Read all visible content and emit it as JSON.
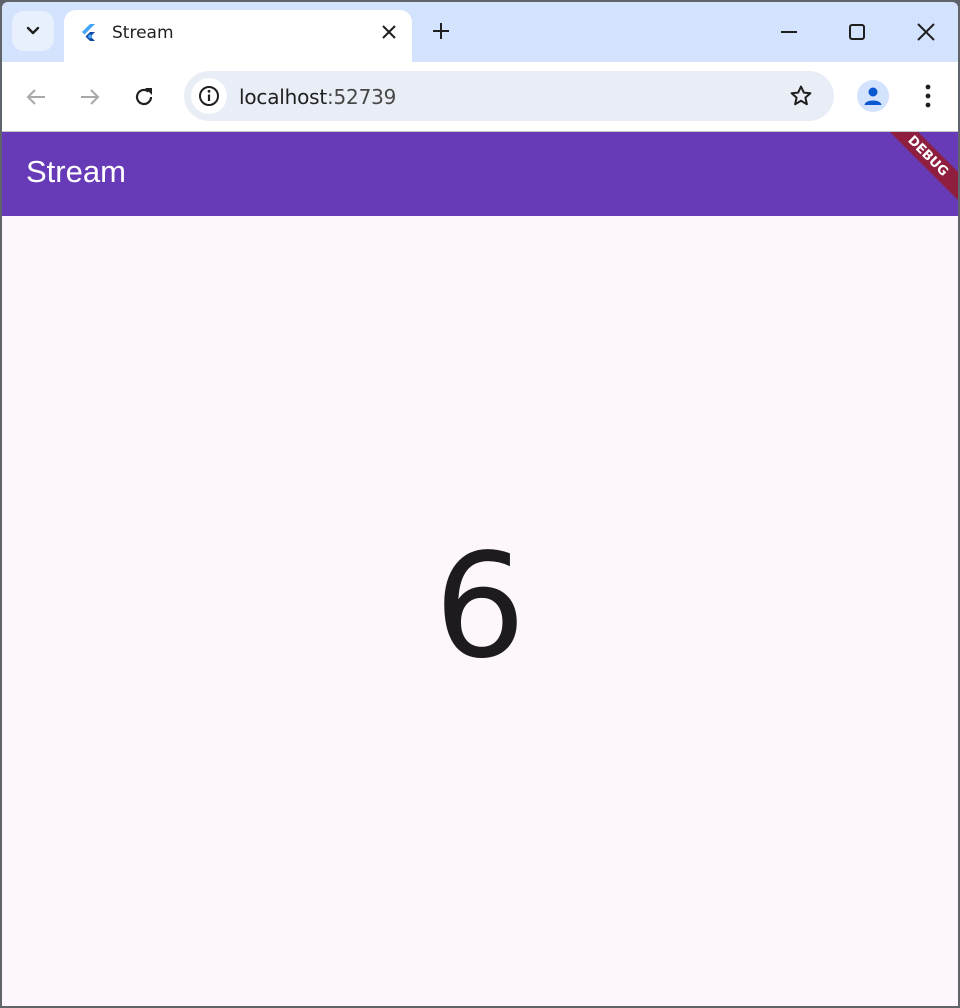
{
  "browser": {
    "tab": {
      "title": "Stream",
      "favicon": "flutter-icon"
    },
    "address": {
      "host": "localhost",
      "port": ":52739"
    },
    "colors": {
      "tabstrip": "#d3e3fd",
      "omnibox": "#e9eef6"
    }
  },
  "app": {
    "title": "Stream",
    "debug_banner": "DEBUG",
    "counter_value": "6",
    "colors": {
      "appbar": "#673ab7",
      "background": "#fdf7fd",
      "banner": "#8e1f3f"
    }
  }
}
